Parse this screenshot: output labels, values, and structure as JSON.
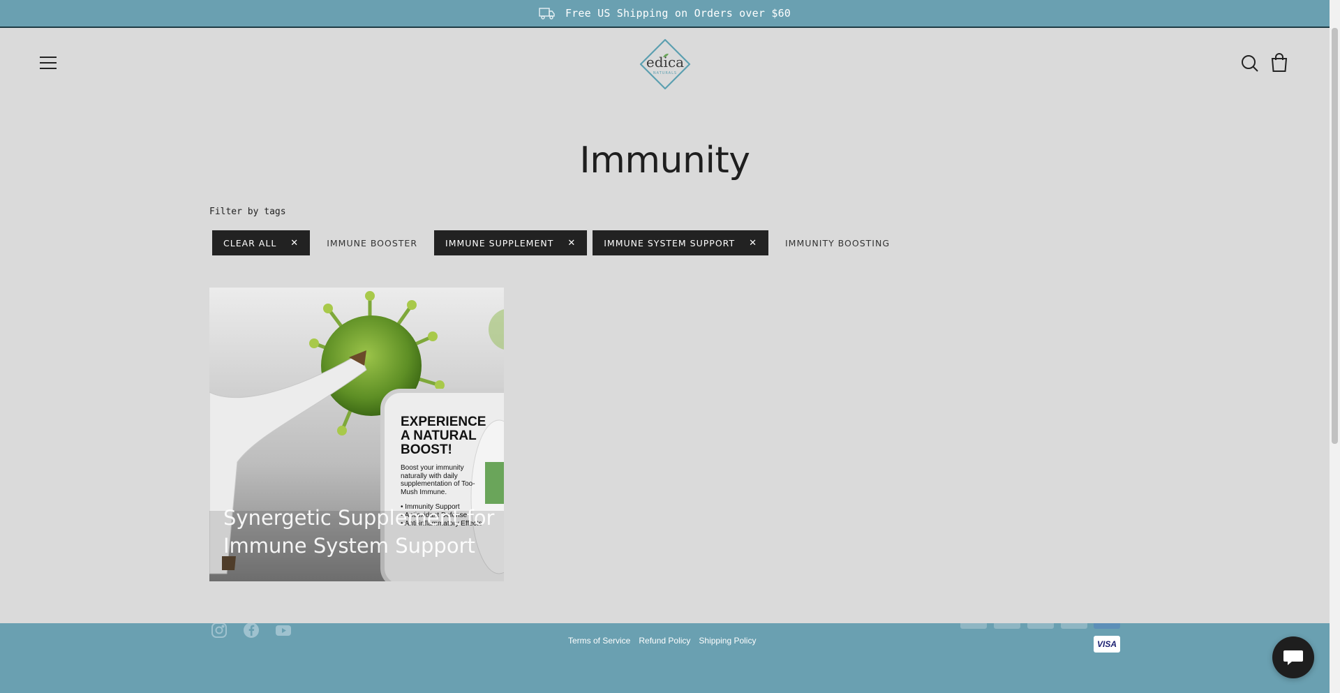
{
  "announcement": {
    "text": "Free US Shipping on Orders over $60",
    "icon": "truck-icon"
  },
  "header": {
    "logo_text": "edica",
    "logo_subtext": "NATURALS",
    "icons": [
      "menu-icon",
      "search-icon",
      "cart-icon"
    ]
  },
  "page": {
    "title": "Immunity",
    "filter_label": "Filter by tags"
  },
  "tags": [
    {
      "label": "CLEAR ALL",
      "active": true
    },
    {
      "label": "IMMUNE BOOSTER",
      "active": false
    },
    {
      "label": "IMMUNE SUPPLEMENT",
      "active": true
    },
    {
      "label": "IMMUNE SYSTEM SUPPORT",
      "active": true
    },
    {
      "label": "IMMUNITY BOOSTING",
      "active": false
    }
  ],
  "product": {
    "title": "Synergetic Supplement for Immune System Support",
    "image_headline": "EXPERIENCE A NATURAL BOOST!",
    "image_subtext": "Boost your immunity naturally with daily supplementation of Too-Mush Immune.",
    "image_bullets": [
      "• Immunity Support",
      "• Antioxidant Defense",
      "• Anti-inflammatory Effects"
    ]
  },
  "footer": {
    "social": [
      "instagram-icon",
      "facebook-icon",
      "youtube-icon"
    ],
    "links": [
      "Terms of Service",
      "Refund Policy",
      "Shipping Policy"
    ],
    "payment_visible_label": "VISA"
  },
  "colors": {
    "accent": "#6aa0b1",
    "page_bg": "#dadada",
    "dark": "#222222"
  }
}
